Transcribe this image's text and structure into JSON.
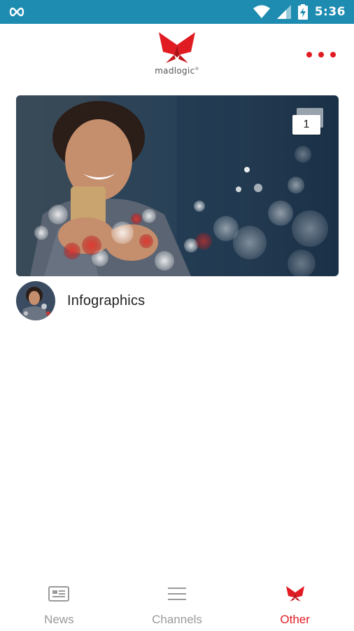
{
  "status_bar": {
    "time": "5:36",
    "icons": [
      "infinity-icon",
      "wifi-icon",
      "signal-icon",
      "battery-charging-icon"
    ]
  },
  "header": {
    "logo_text": "madlogic",
    "logo_mark": "®",
    "menu_icon": "more-dots-icon"
  },
  "colors": {
    "status_bar": "#1e8bb0",
    "accent": "#e11b22",
    "nav_inactive": "#9a9a9a"
  },
  "card": {
    "count": "1"
  },
  "channel": {
    "label": "Infographics"
  },
  "bottom_nav": {
    "items": [
      {
        "label": "News",
        "icon": "newspaper-icon",
        "active": false
      },
      {
        "label": "Channels",
        "icon": "menu-lines-icon",
        "active": false
      },
      {
        "label": "Other",
        "icon": "madlogic-bird-icon",
        "active": true
      }
    ]
  }
}
